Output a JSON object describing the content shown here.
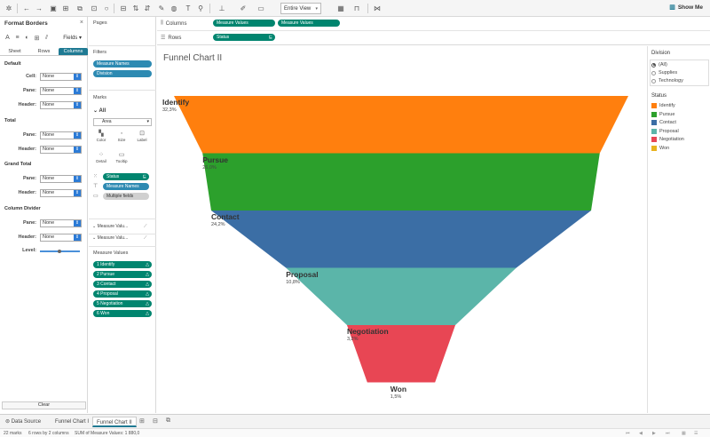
{
  "toolbar": {
    "view_size": "Entire View",
    "show_me": "Show Me"
  },
  "format_panel": {
    "title": "Format Borders",
    "fields_label": "Fields",
    "tabs": [
      "Sheet",
      "Rows",
      "Columns"
    ],
    "active_tab": "Columns",
    "sections": {
      "default": "Default",
      "total": "Total",
      "grand_total": "Grand Total",
      "column_divider": "Column Divider"
    },
    "labels": {
      "cell": "Cell:",
      "pane": "Pane:",
      "header": "Header:",
      "level": "Level:"
    },
    "none_value": "None",
    "clear": "Clear"
  },
  "cards": {
    "pages": "Pages",
    "filters": "Filters",
    "filter_pills": [
      "Measure Names",
      "Division"
    ],
    "marks": "Marks",
    "marks_all": "All",
    "mark_type": "Area",
    "mark_buttons": [
      "Color",
      "Size",
      "Label",
      "Detail",
      "Tooltip"
    ],
    "encodings": [
      "Status",
      "Measure Names",
      "Multiple fields"
    ],
    "measure_value_cards": [
      "Measure Valu...",
      "Measure Valu..."
    ],
    "measure_values_title": "Measure Values",
    "measure_values": [
      "1 Identify",
      "2 Pursue",
      "3 Contact",
      "4 Proposal",
      "5 Negotiation",
      "6 Won"
    ]
  },
  "shelves": {
    "columns_label": "Columns",
    "rows_label": "Rows",
    "columns_pills": [
      "Measure Values",
      "Measure Values"
    ],
    "rows_pills": [
      "Status"
    ]
  },
  "view": {
    "title": "Funnel Chart II"
  },
  "chart_data": {
    "type": "area",
    "title": "Funnel Chart II",
    "stages": [
      "Identify",
      "Pursue",
      "Contact",
      "Proposal",
      "Negotiation",
      "Won"
    ],
    "values": [
      32.3,
      26.0,
      24.2,
      10.8,
      3.2,
      1.5
    ],
    "value_labels": [
      "32,3%",
      "26,0%",
      "24,2%",
      "10,8%",
      "3,2%",
      "1,5%"
    ],
    "colors": [
      "#ff7f0e",
      "#2ca02c",
      "#3b6ea5",
      "#5bb5a9",
      "#e84654",
      "#e8b21e"
    ]
  },
  "legends": {
    "division_title": "Division",
    "division_items": [
      "(All)",
      "Supplies",
      "Technology"
    ],
    "division_selected": "(All)",
    "status_title": "Status",
    "status_items": [
      "Identify",
      "Pursue",
      "Contact",
      "Proposal",
      "Negotiation",
      "Won"
    ],
    "status_colors": [
      "#ff7f0e",
      "#2ca02c",
      "#3b6ea5",
      "#5bb5a9",
      "#e84654",
      "#e8b21e"
    ]
  },
  "tabs": {
    "data_source": "Data Source",
    "sheets": [
      "Funnel Chart I",
      "Funnel Chart II"
    ],
    "active_sheet": "Funnel Chart II"
  },
  "status_bar": {
    "marks": "22 marks",
    "rows_cols": "6 rows by 2 columns",
    "sum": "SUM of Measure Values: 1 880,0"
  }
}
